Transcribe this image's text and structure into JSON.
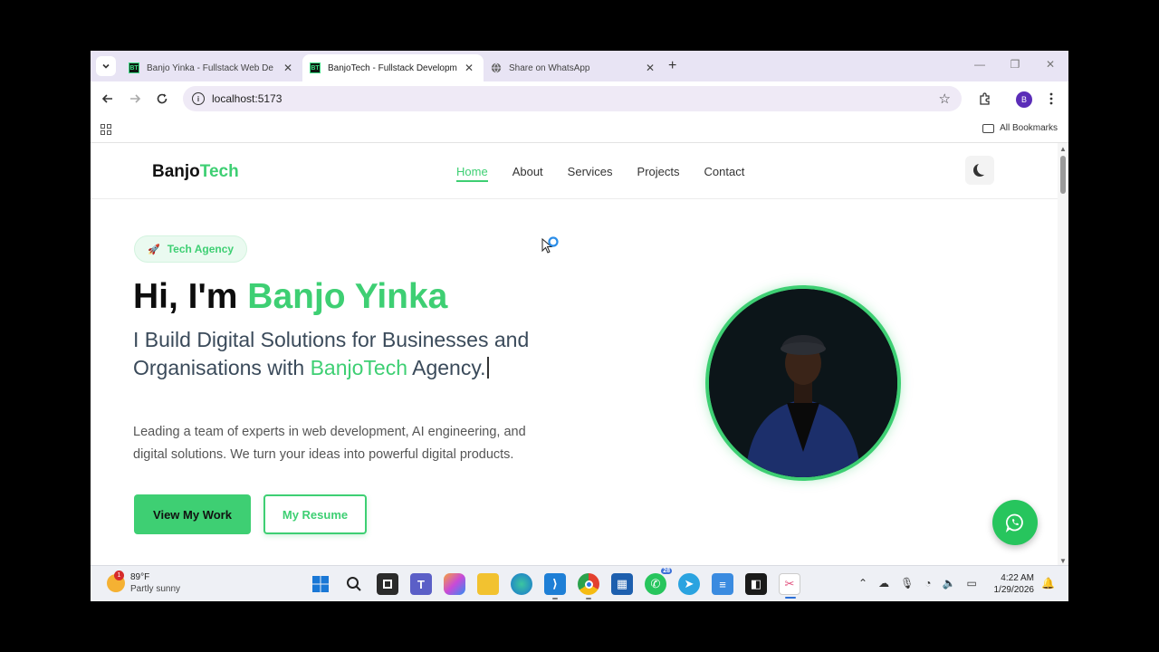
{
  "browser": {
    "tabs": [
      {
        "favicon": "BT",
        "title": "Banjo Yinka - Fullstack Web De",
        "active": false
      },
      {
        "favicon": "BT",
        "title": "BanjoTech - Fullstack Developm",
        "active": true
      },
      {
        "favicon": "globe-icon",
        "title": "Share on WhatsApp",
        "active": false
      }
    ],
    "url": "localhost:5173",
    "profile_initial": "B",
    "bookmarks_label": "All Bookmarks"
  },
  "site": {
    "logo_main": "Banjo",
    "logo_accent": "Tech",
    "nav": [
      {
        "label": "Home",
        "active": true
      },
      {
        "label": "About",
        "active": false
      },
      {
        "label": "Services",
        "active": false
      },
      {
        "label": "Projects",
        "active": false
      },
      {
        "label": "Contact",
        "active": false
      }
    ],
    "hero": {
      "badge": "Tech Agency",
      "title_prefix": "Hi, I'm ",
      "title_name": "Banjo Yinka",
      "subtitle_a": "I Build Digital Solutions for Businesses and Organisations with ",
      "subtitle_brand": "BanjoTech",
      "subtitle_b": " Agency.",
      "description": "Leading a team of experts in web development, AI engineering, and digital solutions. We turn your ideas into powerful digital products.",
      "primary_button": "View My Work",
      "secondary_button": "My Resume"
    },
    "accent_color": "#3ecf73"
  },
  "taskbar": {
    "weather_temp": "89°F",
    "weather_condition": "Partly sunny",
    "weather_alert_count": "1",
    "whatsapp_badge": "28",
    "time": "4:22 AM",
    "date": "1/29/2026"
  }
}
